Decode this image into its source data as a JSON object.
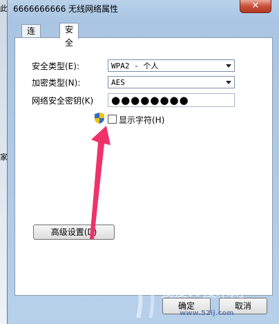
{
  "left_strip": {
    "top_char": "此",
    "bottom_char": "家"
  },
  "window": {
    "title": "6666666666 无线网络属性",
    "close_label": "✕"
  },
  "tabs": [
    {
      "label": "连接"
    },
    {
      "label": "安全"
    }
  ],
  "security": {
    "type_label": "安全类型(E):",
    "type_value": "WPA2 - 个人",
    "encryption_label": "加密类型(N):",
    "encryption_value": "AES",
    "key_label": "网络安全密钥(K)",
    "key_value": "●●●●●●●●",
    "show_chars_label": "显示字符(H)",
    "show_chars_checked": false
  },
  "advanced_button": "高级设置(D)",
  "footer": {
    "ok_label": "确定",
    "cancel_label": "取消"
  },
  "watermark": {
    "text": "我爱IT技术网",
    "sub": "www.52ij.com"
  },
  "colors": {
    "arrow": "#f0326a",
    "close": "#c7503a"
  }
}
